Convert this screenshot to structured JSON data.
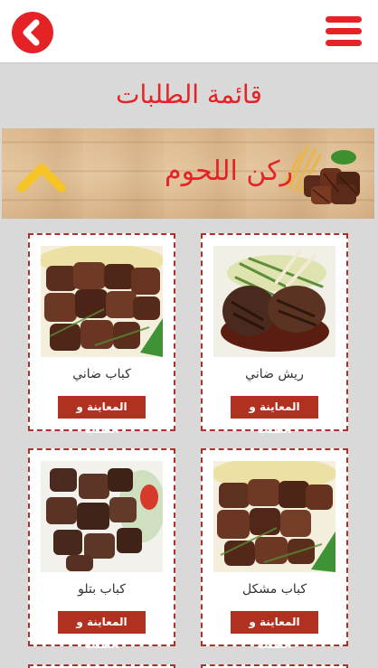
{
  "header": {
    "back_icon": "chevron-left-icon",
    "menu_icon": "hamburger-icon",
    "accent_color": "#e52326"
  },
  "page": {
    "title": "قائمة الطلبات"
  },
  "category_banner": {
    "title": "ركن اللحوم",
    "collapse_icon": "chevron-up-icon"
  },
  "products": [
    {
      "name": "ريش ضاني",
      "button_label": "المعاينة و الطلب",
      "image": "lamb-chops-photo"
    },
    {
      "name": "كباب ضاني",
      "button_label": "المعاينة و الطلب",
      "image": "grilled-lamb-cubes-photo"
    },
    {
      "name": "كباب مشكل",
      "button_label": "المعاينة و الطلب",
      "image": "mixed-kebab-photo"
    },
    {
      "name": "كباب بتلو",
      "button_label": "المعاينة و الطلب",
      "image": "veal-kebab-photo"
    }
  ]
}
